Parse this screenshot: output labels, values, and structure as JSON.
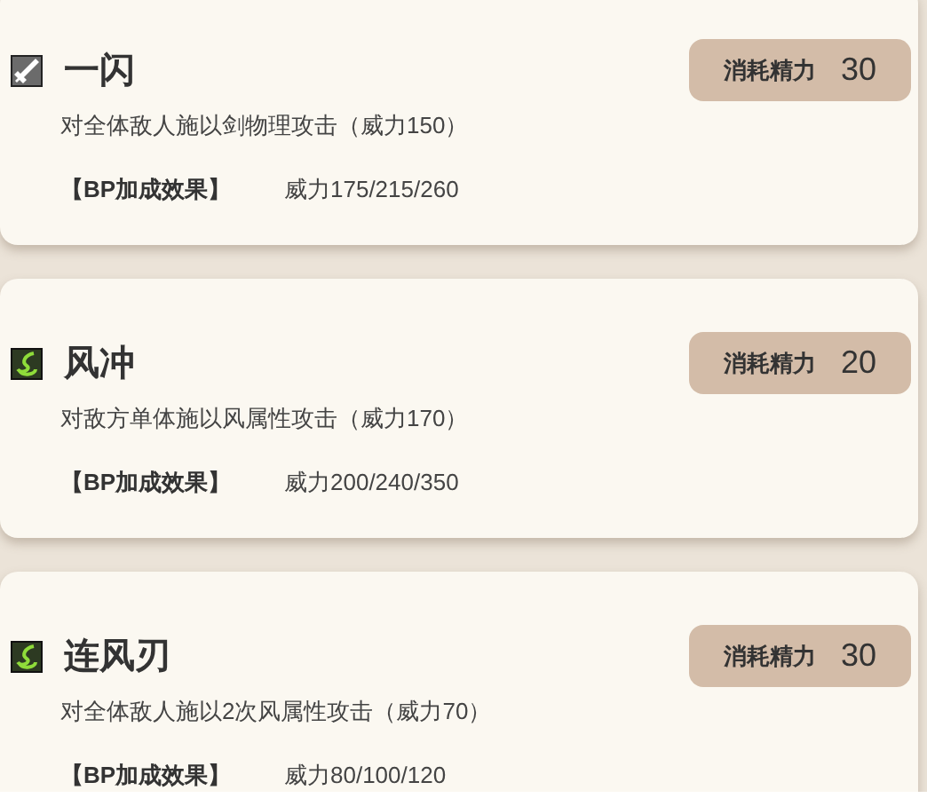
{
  "skills": [
    {
      "kind": "sword",
      "name": "一闪",
      "cost_label": "消耗精力",
      "cost": "30",
      "description": "对全体敌人施以剑物理攻击（威力150）",
      "bp_label": "【BP加成效果】",
      "bp_value": "威力175/215/260"
    },
    {
      "kind": "wind",
      "name": "风冲",
      "cost_label": "消耗精力",
      "cost": "20",
      "description": "对敌方单体施以风属性攻击（威力170）",
      "bp_label": "【BP加成效果】",
      "bp_value": "威力200/240/350"
    },
    {
      "kind": "wind",
      "name": "连风刃",
      "cost_label": "消耗精力",
      "cost": "30",
      "description": "对全体敌人施以2次风属性攻击（威力70）",
      "bp_label": "【BP加成效果】",
      "bp_value": "威力80/100/120"
    }
  ]
}
